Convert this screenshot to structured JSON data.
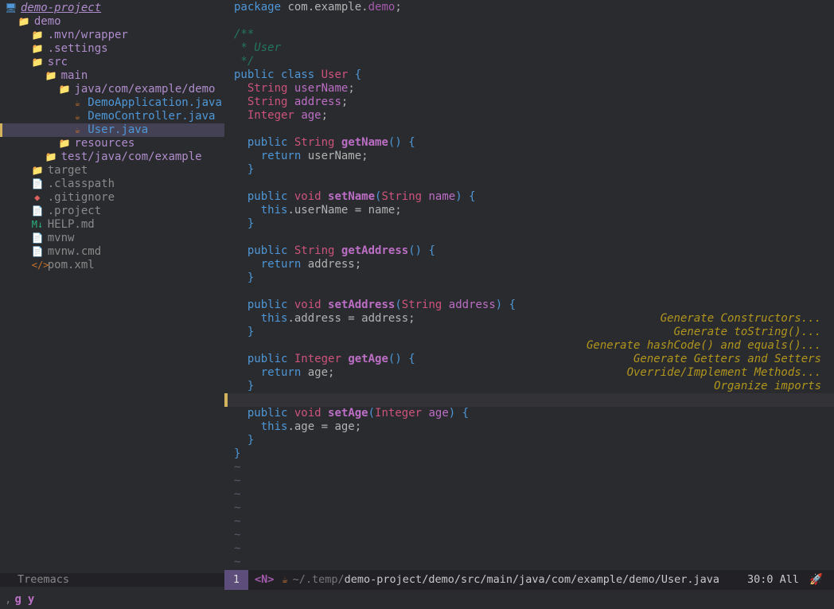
{
  "tree": {
    "rows": [
      {
        "indent": 0,
        "icon": "monitor",
        "label": "demo-project",
        "cls": "proj-name"
      },
      {
        "indent": 1,
        "icon": "folder",
        "label": "demo",
        "cls": "dir-name"
      },
      {
        "indent": 2,
        "icon": "folder",
        "label": ".mvn/wrapper",
        "cls": "dir-name"
      },
      {
        "indent": 2,
        "icon": "folder",
        "label": ".settings",
        "cls": "dir-name"
      },
      {
        "indent": 2,
        "icon": "folder",
        "label": "src",
        "cls": "dir-name"
      },
      {
        "indent": 3,
        "icon": "folder",
        "label": "main",
        "cls": "dir-name"
      },
      {
        "indent": 4,
        "icon": "folder",
        "label": "java/com/example/demo",
        "cls": "dir-name"
      },
      {
        "indent": 5,
        "icon": "java",
        "label": "DemoApplication.java",
        "cls": "file-name"
      },
      {
        "indent": 5,
        "icon": "java",
        "label": "DemoController.java",
        "cls": "file-name"
      },
      {
        "indent": 5,
        "icon": "java",
        "label": "User.java",
        "cls": "file-name",
        "selected": true
      },
      {
        "indent": 4,
        "icon": "folder",
        "label": "resources",
        "cls": "dir-name"
      },
      {
        "indent": 3,
        "icon": "folder",
        "label": "test/java/com/example",
        "cls": "dir-name"
      },
      {
        "indent": 2,
        "icon": "folder",
        "label": "target",
        "cls": "plain-file"
      },
      {
        "indent": 2,
        "icon": "file",
        "label": ".classpath",
        "cls": "plain-file"
      },
      {
        "indent": 2,
        "icon": "git",
        "label": ".gitignore",
        "cls": "plain-file"
      },
      {
        "indent": 2,
        "icon": "file",
        "label": ".project",
        "cls": "plain-file"
      },
      {
        "indent": 2,
        "icon": "md",
        "label": "HELP.md",
        "cls": "plain-file"
      },
      {
        "indent": 2,
        "icon": "file",
        "label": "mvnw",
        "cls": "plain-file"
      },
      {
        "indent": 2,
        "icon": "file",
        "label": "mvnw.cmd",
        "cls": "plain-file"
      },
      {
        "indent": 2,
        "icon": "xml",
        "label": "pom.xml",
        "cls": "plain-file"
      }
    ]
  },
  "code_lines": [
    [
      [
        "k",
        "package"
      ],
      [
        "s",
        " com.example."
      ],
      [
        "con",
        "demo"
      ],
      [
        "s",
        ";"
      ]
    ],
    [],
    [
      [
        "cmt",
        "/**"
      ]
    ],
    [
      [
        "cmt",
        " * User"
      ]
    ],
    [
      [
        "cmt",
        " */"
      ]
    ],
    [
      [
        "k",
        "public"
      ],
      [
        "s",
        " "
      ],
      [
        "k",
        "class"
      ],
      [
        "s",
        " "
      ],
      [
        "ty",
        "User"
      ],
      [
        "s",
        " "
      ],
      [
        "pn",
        "{"
      ]
    ],
    [
      [
        "s",
        "  "
      ],
      [
        "ty",
        "String"
      ],
      [
        "s",
        " "
      ],
      [
        "id",
        "userName"
      ],
      [
        "s",
        ";"
      ]
    ],
    [
      [
        "s",
        "  "
      ],
      [
        "ty",
        "String"
      ],
      [
        "s",
        " "
      ],
      [
        "id",
        "address"
      ],
      [
        "s",
        ";"
      ]
    ],
    [
      [
        "s",
        "  "
      ],
      [
        "ty",
        "Integer"
      ],
      [
        "s",
        " "
      ],
      [
        "id",
        "age"
      ],
      [
        "s",
        ";"
      ]
    ],
    [],
    [
      [
        "s",
        "  "
      ],
      [
        "k",
        "public"
      ],
      [
        "s",
        " "
      ],
      [
        "ty",
        "String"
      ],
      [
        "s",
        " "
      ],
      [
        "fn",
        "getName"
      ],
      [
        "pn",
        "()"
      ],
      [
        "s",
        " "
      ],
      [
        "pn",
        "{"
      ]
    ],
    [
      [
        "s",
        "    "
      ],
      [
        "k",
        "return"
      ],
      [
        "s",
        " userName;"
      ]
    ],
    [
      [
        "s",
        "  "
      ],
      [
        "pn",
        "}"
      ]
    ],
    [],
    [
      [
        "s",
        "  "
      ],
      [
        "k",
        "public"
      ],
      [
        "s",
        " "
      ],
      [
        "ty",
        "void"
      ],
      [
        "s",
        " "
      ],
      [
        "fn",
        "setName"
      ],
      [
        "pn",
        "("
      ],
      [
        "ty",
        "String"
      ],
      [
        "s",
        " "
      ],
      [
        "id",
        "name"
      ],
      [
        "pn",
        ")"
      ],
      [
        "s",
        " "
      ],
      [
        "pn",
        "{"
      ]
    ],
    [
      [
        "s",
        "    "
      ],
      [
        "k",
        "this"
      ],
      [
        "s",
        ".userName = name;"
      ]
    ],
    [
      [
        "s",
        "  "
      ],
      [
        "pn",
        "}"
      ]
    ],
    [],
    [
      [
        "s",
        "  "
      ],
      [
        "k",
        "public"
      ],
      [
        "s",
        " "
      ],
      [
        "ty",
        "String"
      ],
      [
        "s",
        " "
      ],
      [
        "fn",
        "getAddress"
      ],
      [
        "pn",
        "()"
      ],
      [
        "s",
        " "
      ],
      [
        "pn",
        "{"
      ]
    ],
    [
      [
        "s",
        "    "
      ],
      [
        "k",
        "return"
      ],
      [
        "s",
        " address;"
      ]
    ],
    [
      [
        "s",
        "  "
      ],
      [
        "pn",
        "}"
      ]
    ],
    [],
    [
      [
        "s",
        "  "
      ],
      [
        "k",
        "public"
      ],
      [
        "s",
        " "
      ],
      [
        "ty",
        "void"
      ],
      [
        "s",
        " "
      ],
      [
        "fn",
        "setAddress"
      ],
      [
        "pn",
        "("
      ],
      [
        "ty",
        "String"
      ],
      [
        "s",
        " "
      ],
      [
        "id",
        "address"
      ],
      [
        "pn",
        ")"
      ],
      [
        "s",
        " "
      ],
      [
        "pn",
        "{"
      ]
    ],
    [
      [
        "s",
        "    "
      ],
      [
        "k",
        "this"
      ],
      [
        "s",
        ".address = address;"
      ]
    ],
    [
      [
        "s",
        "  "
      ],
      [
        "pn",
        "}"
      ]
    ],
    [],
    [
      [
        "s",
        "  "
      ],
      [
        "k",
        "public"
      ],
      [
        "s",
        " "
      ],
      [
        "ty",
        "Integer"
      ],
      [
        "s",
        " "
      ],
      [
        "fn",
        "getAge"
      ],
      [
        "pn",
        "()"
      ],
      [
        "s",
        " "
      ],
      [
        "pn",
        "{"
      ]
    ],
    [
      [
        "s",
        "    "
      ],
      [
        "k",
        "return"
      ],
      [
        "s",
        " age;"
      ]
    ],
    [
      [
        "s",
        "  "
      ],
      [
        "pn",
        "}"
      ]
    ],
    [
      [
        "cursor",
        ""
      ]
    ],
    [
      [
        "s",
        "  "
      ],
      [
        "k",
        "public"
      ],
      [
        "s",
        " "
      ],
      [
        "ty",
        "void"
      ],
      [
        "s",
        " "
      ],
      [
        "fn",
        "setAge"
      ],
      [
        "pn",
        "("
      ],
      [
        "ty",
        "Integer"
      ],
      [
        "s",
        " "
      ],
      [
        "id",
        "age"
      ],
      [
        "pn",
        ")"
      ],
      [
        "s",
        " "
      ],
      [
        "pn",
        "{"
      ]
    ],
    [
      [
        "s",
        "    "
      ],
      [
        "k",
        "this"
      ],
      [
        "s",
        ".age = age;"
      ]
    ],
    [
      [
        "s",
        "  "
      ],
      [
        "pn",
        "}"
      ]
    ],
    [
      [
        "pn",
        "}"
      ]
    ]
  ],
  "tilde_count": 8,
  "actions": [
    "Generate Constructors...",
    "Generate toString()...",
    "Generate hashCode() and equals()...",
    "Generate Getters and Setters",
    "Override/Implement Methods...",
    "Organize imports"
  ],
  "modeline": {
    "left_label": "Treemacs",
    "line_number": "1",
    "evil_mode": "<N>",
    "path_prefix": "~/.temp/",
    "path_main": "demo-project/demo/src/main/java/com/example/demo/User.java",
    "position": "30:0 All"
  },
  "echo": {
    "prefix": ",",
    "k1": "g",
    "k2": "y"
  },
  "icons": {
    "monitor": "🖥",
    "folder": "📁",
    "java": "☕",
    "file": "📄",
    "git": "◆",
    "md": "M↓",
    "xml": "</>"
  }
}
